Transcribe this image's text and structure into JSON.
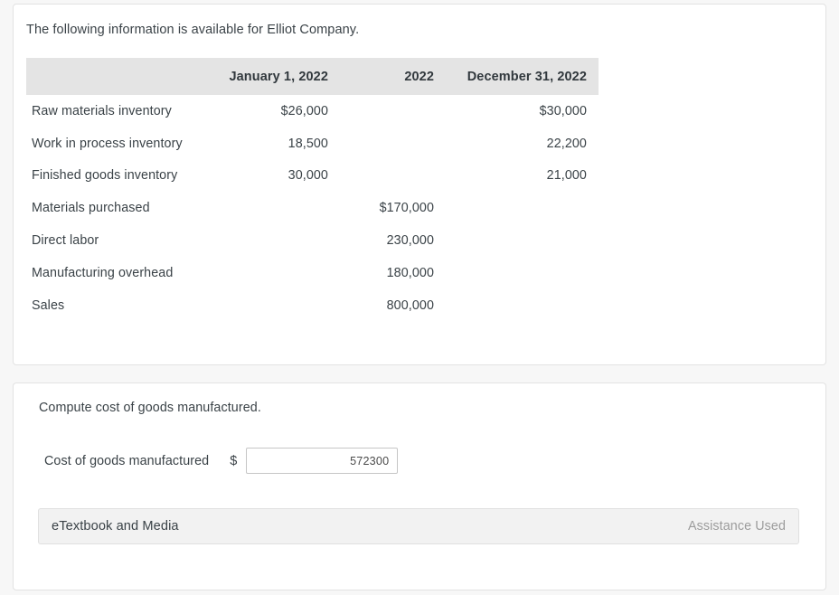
{
  "info_panel": {
    "intro_text": "The following information is available for Elliot Company.",
    "table": {
      "headers": {
        "label_col": "",
        "col1": "January 1, 2022",
        "col2": "2022",
        "col3": "December 31, 2022"
      },
      "rows": [
        {
          "label": "Raw materials inventory",
          "col1": "$26,000",
          "col2": "",
          "col3": "$30,000"
        },
        {
          "label": "Work in process inventory",
          "col1": "18,500",
          "col2": "",
          "col3": "22,200"
        },
        {
          "label": "Finished goods inventory",
          "col1": "30,000",
          "col2": "",
          "col3": "21,000"
        },
        {
          "label": "Materials purchased",
          "col1": "",
          "col2": "$170,000",
          "col3": ""
        },
        {
          "label": "Direct labor",
          "col1": "",
          "col2": "230,000",
          "col3": ""
        },
        {
          "label": "Manufacturing overhead",
          "col1": "",
          "col2": "180,000",
          "col3": ""
        },
        {
          "label": "Sales",
          "col1": "",
          "col2": "800,000",
          "col3": ""
        }
      ]
    }
  },
  "answer_panel": {
    "prompt": "Compute cost of goods manufactured.",
    "answer_label": "Cost of goods manufactured",
    "currency_symbol": "$",
    "answer_value": "572300",
    "answer_placeholder": "",
    "etextbook_label": "eTextbook and Media",
    "assistance_status": "Assistance Used"
  },
  "colors": {
    "page_background": "#f7f7f7",
    "card_background": "#ffffff",
    "card_border": "#e2e2e2",
    "table_header_background": "#e4e4e4",
    "text_primary": "#3a4247",
    "text_muted": "#9c9c9c",
    "bar_background": "#f2f2f2",
    "input_border": "#c6c6c6"
  }
}
